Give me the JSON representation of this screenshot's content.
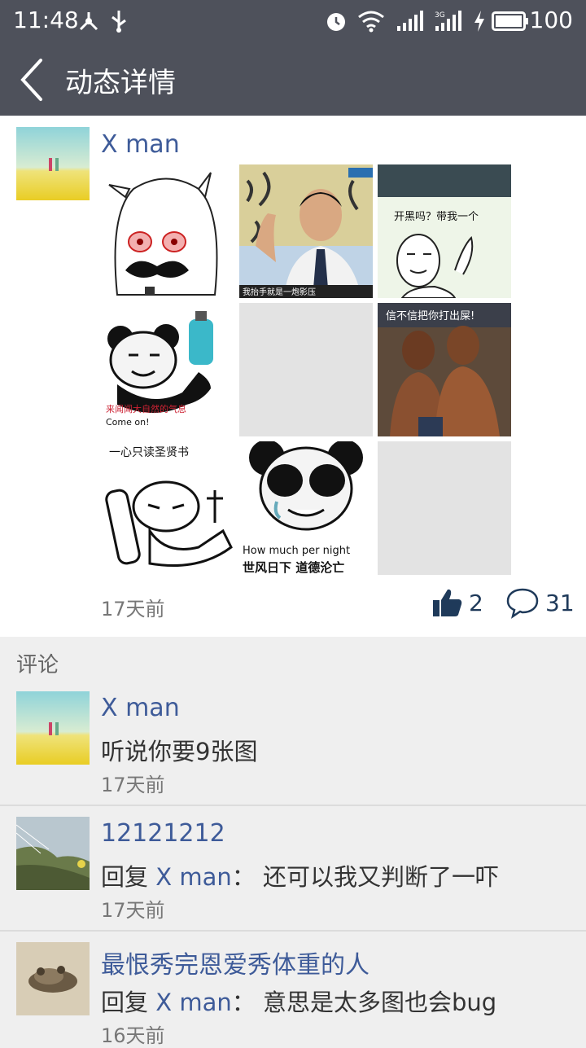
{
  "status": {
    "time": "11:48",
    "battery": "100"
  },
  "nav": {
    "title": "动态详情"
  },
  "post": {
    "author": "X man",
    "time": "17天前",
    "likes": "2",
    "comments": "31",
    "images": [
      {
        "caption": "",
        "type": "anime-girl"
      },
      {
        "caption": "我抬手就是一炮影压",
        "type": "photo"
      },
      {
        "caption": "开黑吗？带我一个",
        "type": "meme"
      },
      {
        "caption": "来闻闻大自然的气息 Come on!",
        "type": "panda"
      },
      {
        "caption": "",
        "type": "empty"
      },
      {
        "caption": "信不信把你打出屎!",
        "type": "photo2"
      },
      {
        "caption": "一心只读圣贤书",
        "type": "reader"
      },
      {
        "caption": "How much per night 世风日下 道德沦亡",
        "type": "panda2"
      },
      {
        "caption": "",
        "type": "empty"
      }
    ]
  },
  "comments_section": {
    "label": "评论"
  },
  "comments": [
    {
      "author": "X man",
      "text": "听说你要9张图",
      "time": "17天前"
    },
    {
      "author": "12121212",
      "reply_prefix": "回复",
      "reply_to": "X man",
      "colon": "：",
      "text": "还可以我又判断了一吓",
      "time": "17天前"
    },
    {
      "author": "最恨秀完恩爱秀体重的人",
      "reply_prefix": "回复",
      "reply_to": "X man",
      "colon": "：",
      "text": "意思是太多图也会bug",
      "time": "16天前"
    }
  ],
  "imgtext": {
    "cap1": "我抬手就是一炮影压",
    "cap2a": "开黑吗？带我一个",
    "cap3a": "来闻闻大自然的气息",
    "cap3b": "Come on!",
    "cap5": "信不信把你打出屎!",
    "cap6": "一心只读圣贤书",
    "cap7a": "How much per night",
    "cap7b": "世风日下 道德沦亡"
  },
  "colors": {
    "topbar": "#4e515b",
    "link": "#3e5b99",
    "like": "#1f3a5a"
  }
}
